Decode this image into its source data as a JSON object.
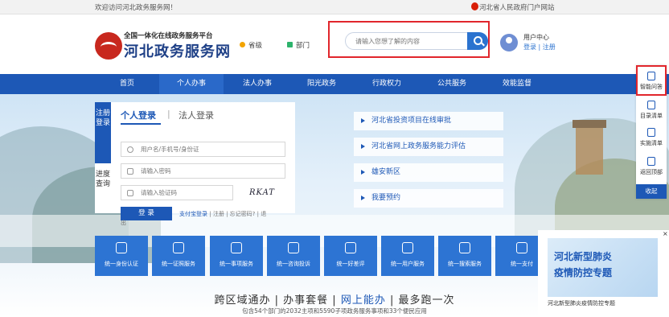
{
  "topbar": {
    "welcome": "欢迎访问河北政务服务网！",
    "gov_link": "河北省人民政府门户网站"
  },
  "header": {
    "logo_subtitle": "全国一体化在线政务服务平台",
    "logo_title": "河北政务服务网",
    "province_label": "省级",
    "dept_label": "部门",
    "search_placeholder": "请输入您想了解的内容",
    "user_center": "用户中心",
    "login": "登录",
    "register": "注册"
  },
  "nav": [
    "首页",
    "个人办事",
    "法人办事",
    "阳光政务",
    "行政权力",
    "公共服务",
    "效能监督"
  ],
  "login_panel": {
    "vtab_register": "注册登录",
    "vtab_progress": "进度查询",
    "tab_person": "个人登录",
    "tab_corp": "法人登录",
    "username_placeholder": "用户名/手机号/身份证",
    "password_placeholder": "请输入密码",
    "code_placeholder": "请输入验证码",
    "captcha_text": "RKAT",
    "login_button": "登 录",
    "alipay_login": "支付宝登录",
    "register": "注册",
    "forgot": "忘记密码?",
    "back": "退",
    "extra": "出"
  },
  "quick_links": [
    "河北省投资项目在线审批",
    "河北省网上政务服务能力评估",
    "雄安新区",
    "我要预约"
  ],
  "tiles": [
    "统一身份认证",
    "统一证照服务",
    "统一事项服务",
    "统一咨询投诉",
    "统一好差评",
    "统一用户服务",
    "统一搜索服务",
    "统一支付"
  ],
  "slogan": {
    "part1": "跨区域通办",
    "part2": "办事套餐",
    "part3": "网上能办",
    "part4": "最多跑一次",
    "sep": "|",
    "sub": "包含54个部门的2032主项和5590子项政务服务事项和33个便民应用"
  },
  "sidebar": {
    "qa": "智能问答",
    "list": "目录清单",
    "category": "实施清单",
    "top": "返回顶部",
    "collapse": "收起"
  },
  "ad": {
    "title_line1": "河北新型肺炎",
    "title_line2": "疫情防控专题",
    "caption": "河北新型肺炎疫情防控专题",
    "close": "×"
  }
}
